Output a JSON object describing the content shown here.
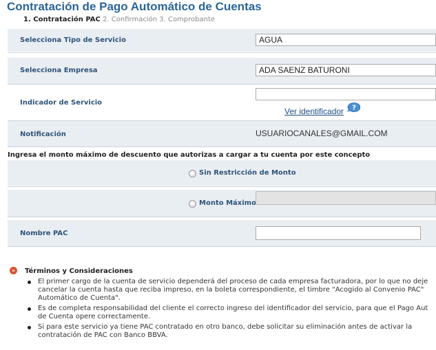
{
  "header": {
    "title": "Contratación de Pago Automático de Cuentas",
    "step_active": "1. Contratación PAC",
    "step_rest": "2. Confirmación 3. Comprobante"
  },
  "form": {
    "tipo_servicio": {
      "label": "Selecciona Tipo de Servicio",
      "value": "AGUA"
    },
    "empresa": {
      "label": "Selecciona Empresa",
      "value": "ADA SAENZ BATURONI"
    },
    "indicador": {
      "label": "Indicador de Servicio",
      "value": "",
      "link": "Ver identificador"
    },
    "notificacion": {
      "label": "Notificación",
      "value": "USUARIOCANALES@GMAIL.COM"
    },
    "monto_prompt": "Ingresa el monto máximo de descuento que autorizas a cargar a tu cuenta por este concepto",
    "sin_restriccion": "Sin Restricción de Monto",
    "monto_maximo": "Monto Máximo",
    "nombre_pac": {
      "label": "Nombre PAC",
      "value": ""
    }
  },
  "terms": {
    "title": "Términos y Consideraciones",
    "items": [
      [
        "El primer cargo de la cuenta de servicio dependerá del proceso de cada empresa facturadora, por lo que no deje",
        "cancelar la cuenta hasta que reciba impreso, en la boleta correspondiente, el timbre \"Acogido al Convenio PAC\"",
        "Automático de Cuenta\"."
      ],
      [
        "Es de completa responsabilidad del cliente el correcto ingreso del identificador del servicio, para que el Pago Aut",
        "de Cuenta opere correctamente."
      ],
      [
        "Si para este servicio ya tiene PAC contratado en otro banco, debe solicitar su eliminación antes de activar la",
        "contratación de PAC con Banco BBVA."
      ]
    ]
  },
  "colors": {
    "title": "#2a6599",
    "row_bg": "#e9eef3",
    "label": "#2f5378",
    "link": "#1f4e87",
    "terms_icon": "#d9532c"
  },
  "icons": {
    "help": "help-question-icon",
    "terms": "chevron-circle-icon"
  }
}
